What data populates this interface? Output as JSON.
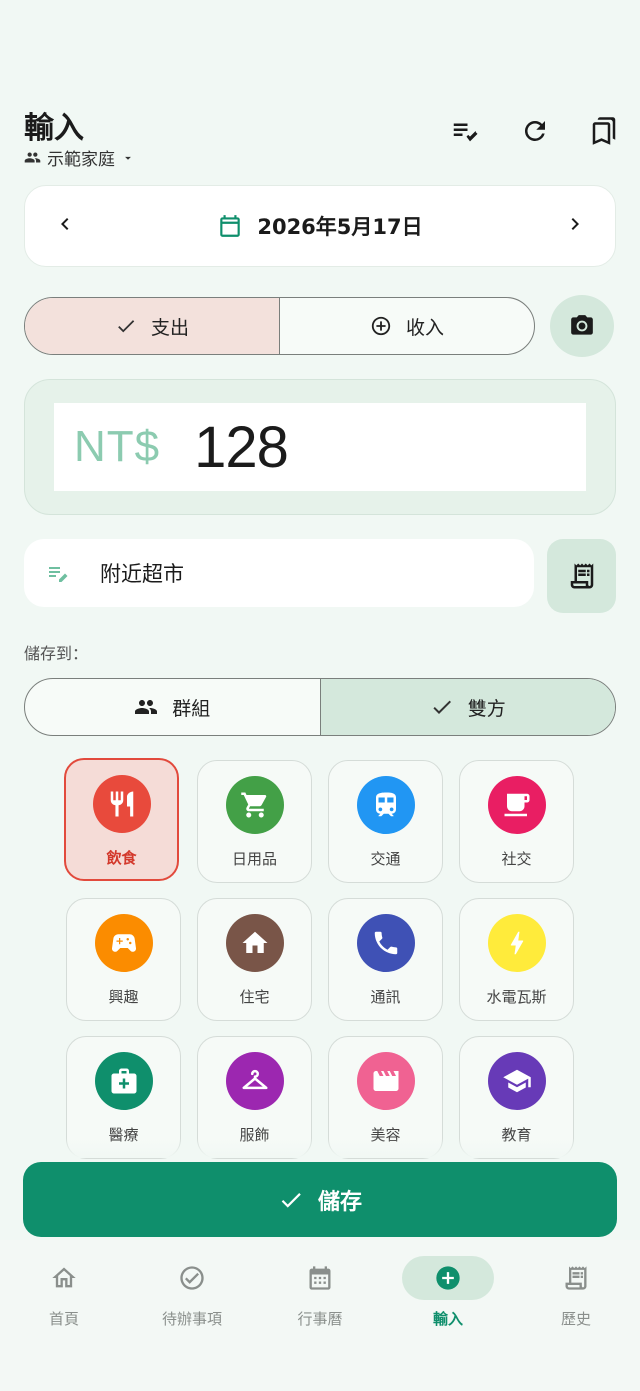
{
  "header": {
    "title": "輸入",
    "household": "示範家庭"
  },
  "date": {
    "text": "2026年5月17日"
  },
  "type_toggle": {
    "expense": "支出",
    "income": "收入",
    "selected": "expense"
  },
  "amount": {
    "currency": "NT$",
    "value": "128"
  },
  "note": {
    "value": "附近超市"
  },
  "save_to": {
    "label": "儲存到：",
    "group": "群組",
    "both": "雙方",
    "selected": "both"
  },
  "categories": [
    {
      "label": "飲食",
      "color": "#e84a3c",
      "icon": "restaurant-icon",
      "selected": true
    },
    {
      "label": "日用品",
      "color": "#43a047",
      "icon": "cart-icon",
      "selected": false
    },
    {
      "label": "交通",
      "color": "#2196f3",
      "icon": "train-icon",
      "selected": false
    },
    {
      "label": "社交",
      "color": "#e91e63",
      "icon": "coffee-icon",
      "selected": false
    },
    {
      "label": "興趣",
      "color": "#fb8c00",
      "icon": "gamepad-icon",
      "selected": false
    },
    {
      "label": "住宅",
      "color": "#795548",
      "icon": "home-icon",
      "selected": false
    },
    {
      "label": "通訊",
      "color": "#3f51b5",
      "icon": "phone-icon",
      "selected": false
    },
    {
      "label": "水電瓦斯",
      "color": "#ffeb3b",
      "icon": "bolt-icon",
      "selected": false
    },
    {
      "label": "醫療",
      "color": "#0f8f6c",
      "icon": "medical-kit-icon",
      "selected": false
    },
    {
      "label": "服飾",
      "color": "#9c27b0",
      "icon": "hanger-icon",
      "selected": false
    },
    {
      "label": "美容",
      "color": "#f06292",
      "icon": "clapper-icon",
      "selected": false
    },
    {
      "label": "教育",
      "color": "#673ab7",
      "icon": "graduation-cap-icon",
      "selected": false
    }
  ],
  "save_button": {
    "label": "儲存"
  },
  "nav": {
    "items": [
      {
        "label": "首頁",
        "icon": "home-outline-icon"
      },
      {
        "label": "待辦事項",
        "icon": "check-circle-icon"
      },
      {
        "label": "行事曆",
        "icon": "calendar-icon"
      },
      {
        "label": "輸入",
        "icon": "add-circle-icon",
        "active": true
      },
      {
        "label": "歷史",
        "icon": "receipt-icon"
      }
    ]
  },
  "colors": {
    "primary": "#0f8f6c",
    "accent_soft": "#d4e8dc",
    "selected_red": "#e24a3c"
  }
}
